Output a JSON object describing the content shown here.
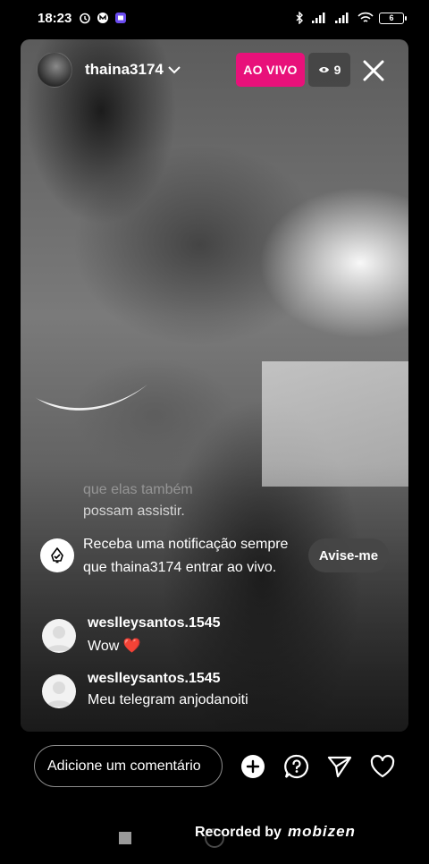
{
  "status_bar": {
    "time": "18:23",
    "battery": "6"
  },
  "live": {
    "username": "thaina3174",
    "live_label": "AO VIVO",
    "viewer_count": "9"
  },
  "caption": {
    "line1": "que elas também",
    "line2": "possam assistir."
  },
  "notification": {
    "text": "Receba uma notificação sempre que thaina3174 entrar ao vivo.",
    "button_label": "Avise-me"
  },
  "comments": [
    {
      "user": "weslleysantos.1545",
      "text": "Wow",
      "emoji": "❤️"
    },
    {
      "user": "weslleysantos.1545",
      "text": "Meu telegram anjodanoiti"
    }
  ],
  "comment_bar": {
    "placeholder": "Adicione um comentário"
  },
  "recorder": {
    "label": "Recorded by",
    "logo": "mobizen"
  },
  "colors": {
    "live_badge": "#e8117a",
    "heart": "#e0245e"
  }
}
